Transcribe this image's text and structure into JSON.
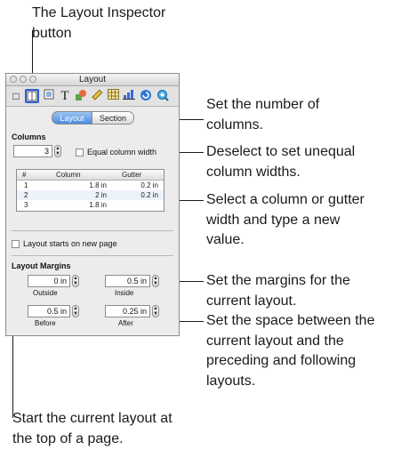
{
  "callouts": {
    "inspector_button_line1": "The Layout Inspector",
    "inspector_button_line2": "button",
    "num_columns_line1": "Set the number of",
    "num_columns_line2": "columns.",
    "equal_width_line1": "Deselect to set unequal",
    "equal_width_line2": "column widths.",
    "column_width_line1": "Select a column or gutter",
    "column_width_line2": "width and type a new",
    "column_width_line3": "value.",
    "margins_line1": "Set the margins for the",
    "margins_line2": "current layout.",
    "space_line1": "Set the space between the",
    "space_line2": "current layout and the",
    "space_line3": "preceding and following",
    "space_line4": "layouts.",
    "new_page_line1": "Start the current layout at",
    "new_page_line2": "the top of a page."
  },
  "panel": {
    "title": "Layout",
    "toolbar_icons": [
      "document-icon",
      "layout-icon",
      "wrap-icon",
      "text-icon",
      "graphic-icon",
      "metrics-icon",
      "table-icon",
      "chart-icon",
      "link-icon",
      "quicktime-icon"
    ],
    "tabs": {
      "layout": "Layout",
      "section": "Section"
    },
    "columns": {
      "header": "Columns",
      "count": "3",
      "equal_width_label": "Equal column width",
      "table": {
        "headers": [
          "#",
          "Column",
          "Gutter"
        ],
        "rows": [
          {
            "num": "1",
            "column": "1.8 in",
            "gutter": "0.2 in"
          },
          {
            "num": "2",
            "column": "2 in",
            "gutter": "0.2 in"
          },
          {
            "num": "3",
            "column": "1.8 in",
            "gutter": ""
          }
        ]
      }
    },
    "new_page_label": "Layout starts on new page",
    "margins": {
      "header": "Layout Margins",
      "outside": {
        "value": "0 in",
        "label": "Outside"
      },
      "inside": {
        "value": "0.5 in",
        "label": "Inside"
      },
      "before": {
        "value": "0.5 in",
        "label": "Before"
      },
      "after": {
        "value": "0.25 in",
        "label": "After"
      }
    }
  }
}
